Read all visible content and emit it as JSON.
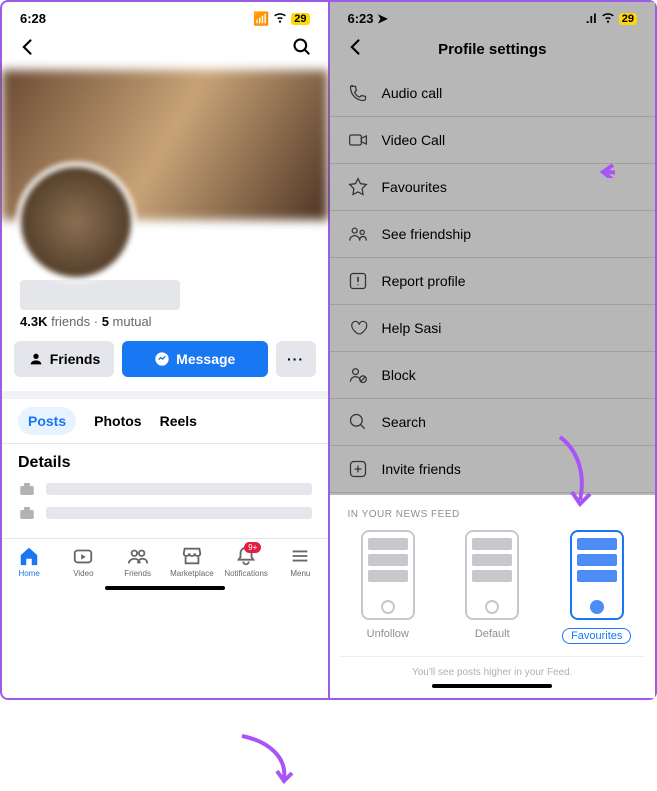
{
  "left": {
    "status": {
      "time": "6:28",
      "battery": "29"
    },
    "friends_count": "4.3K",
    "friends_label": "friends",
    "mutual_count": "5",
    "mutual_label": "mutual",
    "buttons": {
      "friends": "Friends",
      "message": "Message",
      "more": "···"
    },
    "tabs": {
      "posts": "Posts",
      "photos": "Photos",
      "reels": "Reels"
    },
    "details_heading": "Details",
    "nav": {
      "home": "Home",
      "video": "Video",
      "friends": "Friends",
      "marketplace": "Marketplace",
      "notifications": "Notifications",
      "menu": "Menu",
      "badge": "9+"
    }
  },
  "right": {
    "status": {
      "time": "6:23",
      "battery": "29"
    },
    "title": "Profile settings",
    "items": {
      "audio": "Audio call",
      "video": "Video Call",
      "fav": "Favourites",
      "friendship": "See friendship",
      "report": "Report profile",
      "help": "Help Sasi",
      "block": "Block",
      "search": "Search",
      "invite": "Invite friends"
    },
    "sheet": {
      "label": "IN YOUR NEWS FEED",
      "unfollow": "Unfollow",
      "default": "Default",
      "favourites": "Favourites",
      "footnote": "You'll see posts higher in your Feed."
    }
  }
}
